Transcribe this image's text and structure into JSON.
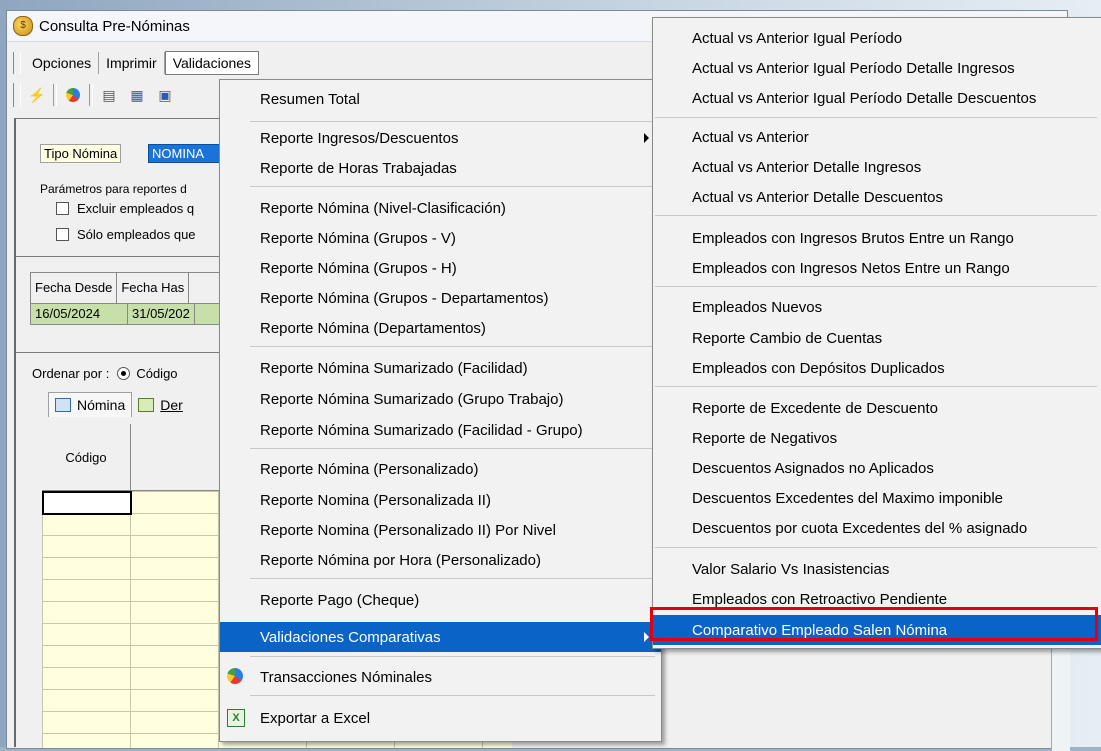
{
  "window": {
    "title": "Consulta Pre-Nóminas"
  },
  "menubar": {
    "items": [
      "Opciones",
      "Imprimir",
      "Validaciones"
    ]
  },
  "panel": {
    "tipo_label": "Tipo Nómina",
    "tipo_value": "NOMINA",
    "params_text": "Parámetros para reportes d",
    "chk1": "Excluir empleados q",
    "chk2": "Sólo empleados que"
  },
  "dates": {
    "headers": [
      "Fecha Desde",
      "Fecha Has"
    ],
    "values": [
      "16/05/2024",
      "31/05/202"
    ]
  },
  "order": {
    "label": "Ordenar por :",
    "option": "Código"
  },
  "tabs": [
    "Nómina",
    "Der"
  ],
  "grid": {
    "header": "Código"
  },
  "menu_validaciones": [
    {
      "label": "Resumen Total"
    },
    {
      "label": "Reporte Ingresos/Descuentos",
      "submenu": true
    },
    {
      "label": "Reporte de Horas Trabajadas"
    },
    {
      "label": "Reporte Nómina (Nivel-Clasificación)"
    },
    {
      "label": "Reporte Nómina (Grupos - V)"
    },
    {
      "label": "Reporte Nómina (Grupos - H)"
    },
    {
      "label": "Reporte Nómina (Grupos - Departamentos)"
    },
    {
      "label": "Reporte Nómina (Departamentos)"
    },
    {
      "label": "Reporte Nómina Sumarizado (Facilidad)"
    },
    {
      "label": "Reporte Nómina Sumarizado (Grupo Trabajo)"
    },
    {
      "label": "Reporte Nómina Sumarizado (Facilidad - Grupo)"
    },
    {
      "label": "Reporte Nómina (Personalizado)"
    },
    {
      "label": "Reporte Nomina (Personalizada II)"
    },
    {
      "label": "Reporte Nomina (Personalizado II) Por Nivel"
    },
    {
      "label": "Reporte Nómina por Hora (Personalizado)"
    },
    {
      "label": "Reporte Pago (Cheque)"
    },
    {
      "label": "Validaciones Comparativas",
      "submenu": true,
      "highlighted": true
    },
    {
      "label": "Transacciones Nóminales",
      "icon": "chart-icon"
    },
    {
      "label": "Exportar a Excel",
      "icon": "excel-icon"
    }
  ],
  "menu_comparativas": [
    {
      "label": "Actual vs Anterior Igual Período"
    },
    {
      "label": "Actual vs Anterior Igual Período Detalle Ingresos"
    },
    {
      "label": "Actual vs Anterior Igual Período Detalle Descuentos"
    },
    {
      "label": "Actual vs Anterior"
    },
    {
      "label": "Actual vs Anterior Detalle Ingresos"
    },
    {
      "label": "Actual vs Anterior Detalle Descuentos"
    },
    {
      "label": "Empleados con Ingresos Brutos Entre un Rango"
    },
    {
      "label": "Empleados con Ingresos Netos Entre un Rango"
    },
    {
      "label": "Empleados Nuevos"
    },
    {
      "label": "Reporte Cambio de Cuentas"
    },
    {
      "label": "Empleados con Depósitos Duplicados"
    },
    {
      "label": "Reporte de Excedente de Descuento"
    },
    {
      "label": "Reporte de Negativos"
    },
    {
      "label": "Descuentos Asignados no Aplicados"
    },
    {
      "label": "Descuentos Excedentes del Maximo imponible"
    },
    {
      "label": "Descuentos por cuota Excedentes del % asignado"
    },
    {
      "label": "Valor Salario Vs Inasistencias"
    },
    {
      "label": "Empleados con Retroactivo Pendiente"
    },
    {
      "label": "Comparativo Empleado Salen Nómina",
      "highlighted": true
    }
  ],
  "colors": {
    "highlight": "#0a64c8",
    "annotation_box": "#e0000f",
    "date_row": "#c7e0a9",
    "grid_bg": "#ffffe0"
  }
}
